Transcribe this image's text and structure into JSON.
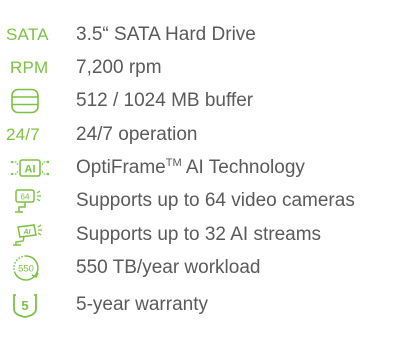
{
  "colors": {
    "accent": "#7cc242",
    "text": "#5a5a5a"
  },
  "specs": [
    {
      "icon": "sata-label",
      "icon_text": "SATA",
      "label": "3.5“ SATA Hard Drive"
    },
    {
      "icon": "rpm-label",
      "icon_text": "RPM",
      "label": "7,200 rpm"
    },
    {
      "icon": "buffer-stack-icon",
      "icon_text": "",
      "label": "512 / 1024 MB buffer"
    },
    {
      "icon": "24-7-label",
      "icon_text": "24/7",
      "label": "24/7 operation"
    },
    {
      "icon": "ai-chip-icon",
      "icon_text": "AI",
      "label_main": "OptiFrame",
      "label_tm": "TM",
      "label_rest": " AI Technology"
    },
    {
      "icon": "camera-64-icon",
      "icon_text": "64",
      "label": "Supports up to 64 video cameras"
    },
    {
      "icon": "ai-camera-icon",
      "icon_text": "AI",
      "label": "Supports up to 32 AI streams"
    },
    {
      "icon": "workload-550-icon",
      "icon_text": "550",
      "label": "550 TB/year workload"
    },
    {
      "icon": "warranty-5-icon",
      "icon_text": "5",
      "label": "5-year warranty"
    }
  ]
}
